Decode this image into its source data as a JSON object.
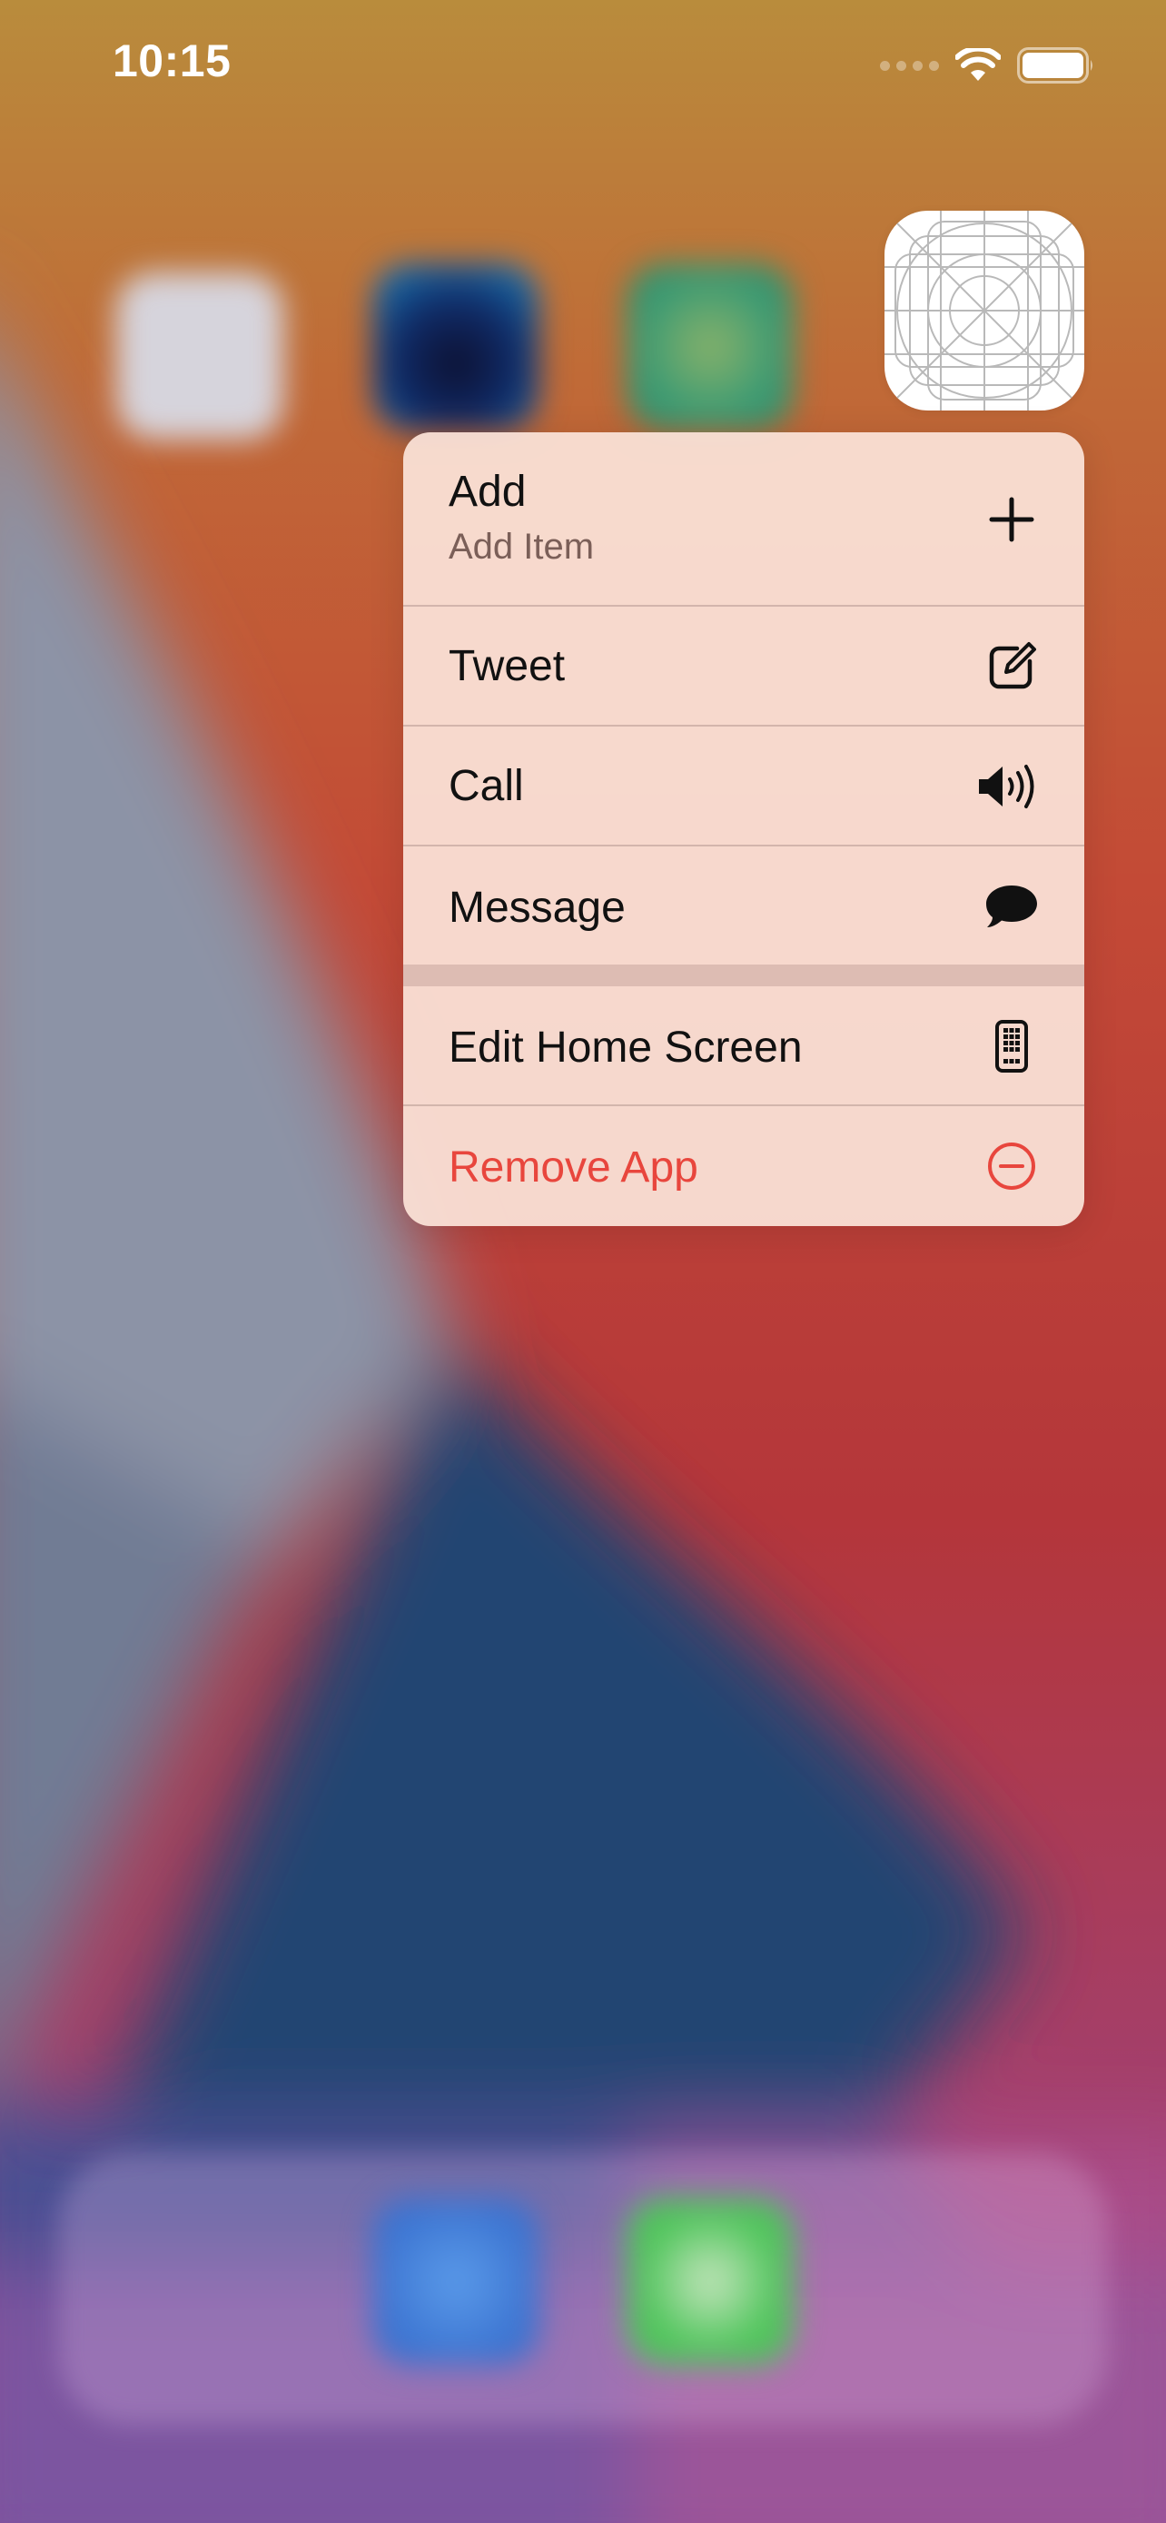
{
  "status_bar": {
    "time": "10:15",
    "icons": [
      "cellular-signal-icon",
      "wifi-icon",
      "battery-icon"
    ]
  },
  "app_icon": {
    "icon": "app-icon-template-grid"
  },
  "context_menu": {
    "items": [
      {
        "title": "Add",
        "subtitle": "Add Item",
        "icon": "plus-icon"
      },
      {
        "title": "Tweet",
        "icon": "compose-icon"
      },
      {
        "title": "Call",
        "icon": "speaker-wave-icon"
      },
      {
        "title": "Message",
        "icon": "message-bubble-icon"
      }
    ],
    "system_items": [
      {
        "title": "Edit Home Screen",
        "icon": "phone-apps-icon"
      },
      {
        "title": "Remove App",
        "icon": "minus-circle-icon",
        "destructive": true
      }
    ]
  },
  "colors": {
    "destructive": "#e8463d",
    "menu_text": "#111111",
    "subtitle_text": "#7b5f58"
  }
}
